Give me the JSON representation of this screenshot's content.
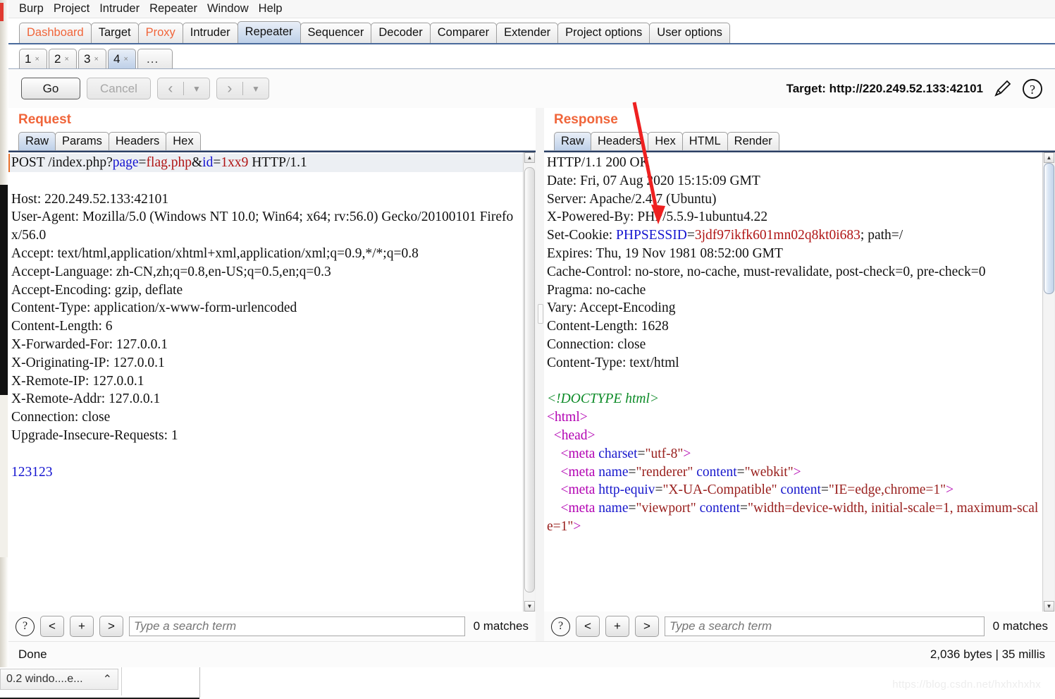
{
  "menu": {
    "items": [
      "Burp",
      "Project",
      "Intruder",
      "Repeater",
      "Window",
      "Help"
    ]
  },
  "main_tabs": [
    {
      "label": "Dashboard",
      "accent": true,
      "selected": false
    },
    {
      "label": "Target",
      "accent": false,
      "selected": false
    },
    {
      "label": "Proxy",
      "accent": true,
      "selected": false
    },
    {
      "label": "Intruder",
      "accent": false,
      "selected": false
    },
    {
      "label": "Repeater",
      "accent": false,
      "selected": true
    },
    {
      "label": "Sequencer",
      "accent": false,
      "selected": false
    },
    {
      "label": "Decoder",
      "accent": false,
      "selected": false
    },
    {
      "label": "Comparer",
      "accent": false,
      "selected": false
    },
    {
      "label": "Extender",
      "accent": false,
      "selected": false
    },
    {
      "label": "Project options",
      "accent": false,
      "selected": false
    },
    {
      "label": "User options",
      "accent": false,
      "selected": false
    }
  ],
  "repeater_tabs": [
    {
      "label": "1",
      "close": "×",
      "selected": false
    },
    {
      "label": "2",
      "close": "×",
      "selected": false
    },
    {
      "label": "3",
      "close": "×",
      "selected": false
    },
    {
      "label": "4",
      "close": "×",
      "selected": true
    }
  ],
  "repeater_overflow_label": "...",
  "toolbar": {
    "go_label": "Go",
    "cancel_label": "Cancel",
    "back_arrow": "‹",
    "forward_arrow": "›",
    "caret": "▼",
    "target_label": "Target: http://220.249.52.133:42101",
    "edit_icon": "pencil-icon",
    "help_icon": "question-circle-icon"
  },
  "request": {
    "title": "Request",
    "tabs": [
      {
        "label": "Raw",
        "selected": true
      },
      {
        "label": "Params",
        "selected": false
      },
      {
        "label": "Headers",
        "selected": false
      },
      {
        "label": "Hex",
        "selected": false
      }
    ],
    "request_line": {
      "method_path": "POST /index.php?",
      "param1_name": "page",
      "param1_eq": "=",
      "param1_value": "flag.php",
      "amp": "&",
      "param2_name": "id",
      "param2_eq": "=",
      "param2_value": "1xx9",
      "version": " HTTP/1.1"
    },
    "headers": [
      "Host: 220.249.52.133:42101",
      "User-Agent: Mozilla/5.0 (Windows NT 10.0; Win64; x64; rv:56.0) Gecko/20100101 Firefox/56.0",
      "Accept: text/html,application/xhtml+xml,application/xml;q=0.9,*/*;q=0.8",
      "Accept-Language: zh-CN,zh;q=0.8,en-US;q=0.5,en;q=0.3",
      "Accept-Encoding: gzip, deflate",
      "Content-Type: application/x-www-form-urlencoded",
      "Content-Length: 6",
      "X-Forwarded-For: 127.0.0.1",
      "X-Originating-IP: 127.0.0.1",
      "X-Remote-IP: 127.0.0.1",
      "X-Remote-Addr: 127.0.0.1",
      "Connection: close",
      "Upgrade-Insecure-Requests: 1"
    ],
    "body": "123123",
    "search": {
      "placeholder": "Type a search term",
      "value": "",
      "matches": "0 matches",
      "prev_label": "<",
      "add_label": "+",
      "next_label": ">",
      "help_label": "?"
    }
  },
  "response": {
    "title": "Response",
    "tabs": [
      {
        "label": "Raw",
        "selected": true
      },
      {
        "label": "Headers",
        "selected": false
      },
      {
        "label": "Hex",
        "selected": false
      },
      {
        "label": "HTML",
        "selected": false
      },
      {
        "label": "Render",
        "selected": false
      }
    ],
    "status_line": "HTTP/1.1 200 OK",
    "headers_before_cookie": [
      "Date: Fri, 07 Aug 2020 15:15:09 GMT",
      "Server: Apache/2.4.7 (Ubuntu)",
      "X-Powered-By: PHP/5.5.9-1ubuntu4.22"
    ],
    "set_cookie": {
      "prefix": "Set-Cookie: ",
      "name": "PHPSESSID",
      "eq": "=",
      "value": "3jdf97ikfk601mn02q8kt0i683",
      "suffix": "; path=/"
    },
    "headers_after_cookie": [
      "Expires: Thu, 19 Nov 1981 08:52:00 GMT",
      "Cache-Control: no-store, no-cache, must-revalidate, post-check=0, pre-check=0",
      "Pragma: no-cache",
      "Vary: Accept-Encoding",
      "Content-Length: 1628",
      "Connection: close",
      "Content-Type: text/html"
    ],
    "body_lines": [
      {
        "indent": 0,
        "parts": [
          {
            "t": "doctype",
            "s": "<!DOCTYPE html>"
          }
        ]
      },
      {
        "indent": 0,
        "parts": [
          {
            "t": "tag",
            "s": "<html>"
          }
        ]
      },
      {
        "indent": 1,
        "parts": [
          {
            "t": "tag",
            "s": "<head>"
          }
        ]
      },
      {
        "indent": 2,
        "parts": [
          {
            "t": "tag",
            "s": "<meta "
          },
          {
            "t": "attr",
            "s": "charset"
          },
          {
            "t": "plain",
            "s": "="
          },
          {
            "t": "val",
            "s": "\"utf-8\""
          },
          {
            "t": "tag",
            "s": ">"
          }
        ]
      },
      {
        "indent": 2,
        "parts": [
          {
            "t": "tag",
            "s": "<meta "
          },
          {
            "t": "attr",
            "s": "name"
          },
          {
            "t": "plain",
            "s": "="
          },
          {
            "t": "val",
            "s": "\"renderer\""
          },
          {
            "t": "plain",
            "s": " "
          },
          {
            "t": "attr",
            "s": "content"
          },
          {
            "t": "plain",
            "s": "="
          },
          {
            "t": "val",
            "s": "\"webkit\""
          },
          {
            "t": "tag",
            "s": ">"
          }
        ]
      },
      {
        "indent": 2,
        "parts": [
          {
            "t": "tag",
            "s": "<meta "
          },
          {
            "t": "attr",
            "s": "http-equiv"
          },
          {
            "t": "plain",
            "s": "="
          },
          {
            "t": "val",
            "s": "\"X-UA-Compatible\""
          },
          {
            "t": "plain",
            "s": " "
          },
          {
            "t": "attr",
            "s": "content"
          },
          {
            "t": "plain",
            "s": "="
          },
          {
            "t": "val",
            "s": "\"IE=edge,chrome=1\""
          },
          {
            "t": "tag",
            "s": ">"
          }
        ]
      },
      {
        "indent": 2,
        "parts": [
          {
            "t": "tag",
            "s": "<meta "
          },
          {
            "t": "attr",
            "s": "name"
          },
          {
            "t": "plain",
            "s": "="
          },
          {
            "t": "val",
            "s": "\"viewport\""
          },
          {
            "t": "plain",
            "s": " "
          },
          {
            "t": "attr",
            "s": "content"
          },
          {
            "t": "plain",
            "s": "="
          },
          {
            "t": "val",
            "s": "\"width=device-width, initial-scale=1, maximum-scale=1\""
          },
          {
            "t": "tag",
            "s": ">"
          }
        ]
      }
    ],
    "search": {
      "placeholder": "Type a search term",
      "value": "",
      "matches": "0 matches",
      "prev_label": "<",
      "add_label": "+",
      "next_label": ">",
      "help_label": "?"
    }
  },
  "status": {
    "left": "Done",
    "right": "2,036 bytes | 35 millis"
  },
  "taskbar": {
    "button_label": "0.2 windo....e...",
    "chevron": "⌃"
  },
  "watermark": "https://blog.csdn.net/hxhxhxhx",
  "colors": {
    "accent_orange": "#f0653a",
    "tab_selected": "#bed0e8",
    "token_blue": "#1414d0",
    "token_red": "#b01414",
    "html_tag": "#b200b2",
    "html_attr": "#1717cc",
    "html_value": "#99201e",
    "doctype_green": "#0b8a26",
    "annotation_red": "#ee2020"
  }
}
